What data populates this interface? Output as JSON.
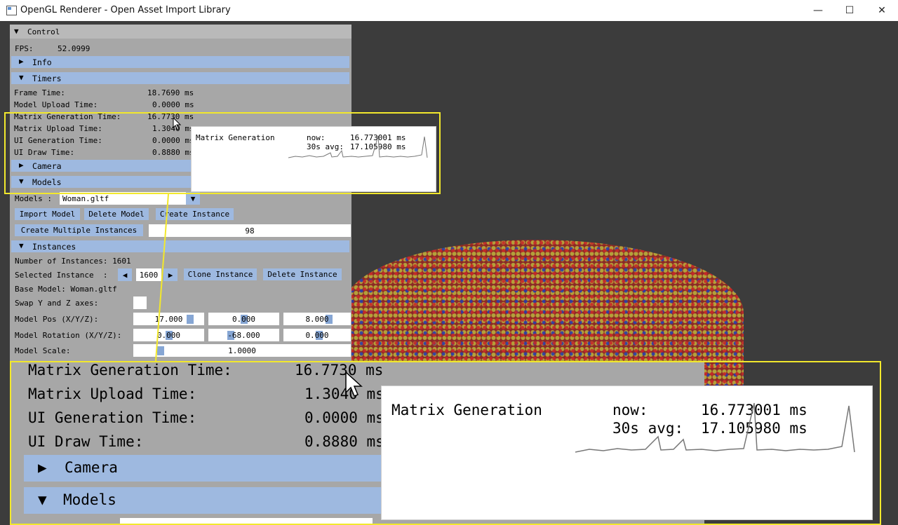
{
  "window": {
    "title": "OpenGL Renderer - Open Asset Import Library",
    "minimize_glyph": "—",
    "maximize_glyph": "☐",
    "close_glyph": "✕"
  },
  "control": {
    "header": "Control",
    "fps_label": "FPS:",
    "fps_value": "52.0999",
    "info_header": "Info",
    "timers_header": "Timers",
    "timers": [
      {
        "label": "Frame Time:",
        "value": "18.7690 ms"
      },
      {
        "label": "Model Upload Time:",
        "value": "0.0000 ms"
      },
      {
        "label": "Matrix Generation Time:",
        "value": "16.7730 ms"
      },
      {
        "label": "Matrix Upload Time:",
        "value": "1.3040 ms"
      },
      {
        "label": "UI Generation Time:",
        "value": "0.0000 ms"
      },
      {
        "label": "UI Draw Time:",
        "value": "0.8880 ms"
      }
    ],
    "camera_header": "Camera",
    "models_header": "Models",
    "models_label": "Models :",
    "models_selected": "Woman.gltf",
    "import_model": "Import Model",
    "delete_model": "Delete Model",
    "create_instance": "Create Instance",
    "create_multiple": "Create Multiple Instances",
    "multiple_count": "98",
    "instances_header": "Instances",
    "num_instances": "Number of Instances: 1601",
    "selected_label": "Selected Instance  :",
    "selected_value": "1600",
    "clone_instance": "Clone Instance",
    "delete_instance": "Delete Instance",
    "base_model": "Base Model: Woman.gltf",
    "swap_axes": "Swap Y and Z axes:",
    "pos_label": "Model Pos (X/Y/Z):",
    "pos_x": "17.000",
    "pos_y": "0.000",
    "pos_z": "8.000",
    "rot_label": "Model Rotation (X/Y/Z):",
    "rot_x": "0.000",
    "rot_y": "-68.000",
    "rot_z": "0.000",
    "scale_label": "Model Scale:",
    "scale_value": "1.0000"
  },
  "tooltip": {
    "title": "Matrix Generation",
    "now_label": "now:",
    "now_value": "16.773001 ms",
    "avg_label": "30s avg:",
    "avg_value": "17.105980 ms"
  },
  "zoom": {
    "rows": [
      {
        "label": "Matrix Generation Time:",
        "value": "16.7730 ms"
      },
      {
        "label": "Matrix Upload Time:",
        "value": "1.3040 ms"
      },
      {
        "label": "UI Generation Time:",
        "value": "0.0000 ms"
      },
      {
        "label": "UI Draw Time:",
        "value": "0.8880 ms"
      }
    ],
    "camera_header": "Camera",
    "models_header": "Models"
  },
  "colors": {
    "header_blue": "#9eb9e0",
    "panel_gray": "#a7a7a7",
    "highlight_yellow": "#f2e82c",
    "viewport_bg": "#3c3c3c"
  },
  "icons": {
    "expanded": "▼",
    "collapsed": "▶",
    "combo_arrow": "▼",
    "step_left": "◀",
    "step_right": "▶"
  }
}
